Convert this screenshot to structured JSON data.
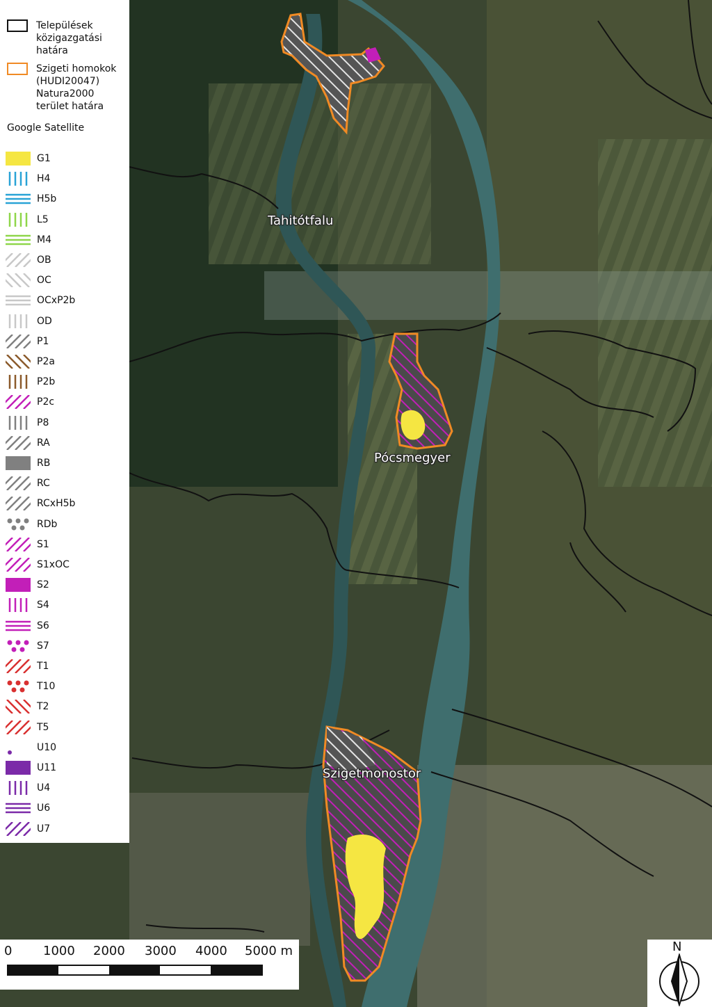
{
  "legend": {
    "boundary_label": "Települések közigazgatási határa",
    "natura_label": "Szigeti homokok (HUDI20047) Natura2000 terület határa",
    "basemap_label": "Google Satellite",
    "items": [
      {
        "code": "G1",
        "color": "#f5e642",
        "pattern": "solid"
      },
      {
        "code": "H4",
        "color": "#29a3d6",
        "pattern": "vert"
      },
      {
        "code": "H5b",
        "color": "#29a3d6",
        "pattern": "horiz"
      },
      {
        "code": "L5",
        "color": "#8fd64a",
        "pattern": "vert"
      },
      {
        "code": "M4",
        "color": "#8fd64a",
        "pattern": "horiz"
      },
      {
        "code": "OB",
        "color": "#c8c8c8",
        "pattern": "diag"
      },
      {
        "code": "OC",
        "color": "#c8c8c8",
        "pattern": "back"
      },
      {
        "code": "OCxP2b",
        "color": "#c8c8c8",
        "pattern": "horiz"
      },
      {
        "code": "OD",
        "color": "#c8c8c8",
        "pattern": "vert"
      },
      {
        "code": "P1",
        "color": "#808080",
        "pattern": "diag"
      },
      {
        "code": "P2a",
        "color": "#8b5a2b",
        "pattern": "back"
      },
      {
        "code": "P2b",
        "color": "#8b5a2b",
        "pattern": "vert"
      },
      {
        "code": "P2c",
        "color": "#c21fb8",
        "pattern": "diag"
      },
      {
        "code": "P8",
        "color": "#808080",
        "pattern": "vert"
      },
      {
        "code": "RA",
        "color": "#808080",
        "pattern": "diag"
      },
      {
        "code": "RB",
        "color": "#808080",
        "pattern": "solid"
      },
      {
        "code": "RC",
        "color": "#808080",
        "pattern": "diag"
      },
      {
        "code": "RCxH5b",
        "color": "#808080",
        "pattern": "diag"
      },
      {
        "code": "RDb",
        "color": "#808080",
        "pattern": "dots"
      },
      {
        "code": "S1",
        "color": "#c21fb8",
        "pattern": "diag"
      },
      {
        "code": "S1xOC",
        "color": "#c21fb8",
        "pattern": "diag"
      },
      {
        "code": "S2",
        "color": "#c21fb8",
        "pattern": "solid"
      },
      {
        "code": "S4",
        "color": "#c21fb8",
        "pattern": "vert"
      },
      {
        "code": "S6",
        "color": "#c21fb8",
        "pattern": "horiz"
      },
      {
        "code": "S7",
        "color": "#c21fb8",
        "pattern": "dots"
      },
      {
        "code": "T1",
        "color": "#d93030",
        "pattern": "diag"
      },
      {
        "code": "T10",
        "color": "#d93030",
        "pattern": "dots"
      },
      {
        "code": "T2",
        "color": "#d93030",
        "pattern": "back"
      },
      {
        "code": "T5",
        "color": "#d93030",
        "pattern": "diag"
      },
      {
        "code": "U10",
        "color": "#7b2aa8",
        "pattern": "dot"
      },
      {
        "code": "U11",
        "color": "#7b2aa8",
        "pattern": "solid"
      },
      {
        "code": "U4",
        "color": "#7b2aa8",
        "pattern": "vert"
      },
      {
        "code": "U6",
        "color": "#7b2aa8",
        "pattern": "horiz"
      },
      {
        "code": "U7",
        "color": "#7b2aa8",
        "pattern": "diag"
      }
    ]
  },
  "places": {
    "tahitotfalu": "Tahitótfalu",
    "pocsmegyer": "Pócsmegyer",
    "szigetmonostor": "Szigetmonostor"
  },
  "scale": {
    "labels": [
      "0",
      "1000",
      "2000",
      "3000",
      "4000",
      "5000 m"
    ]
  },
  "north_label": "N",
  "colors": {
    "natura_boundary": "#f08a24",
    "admin_boundary": "#111111",
    "river": "#3f6e6e"
  }
}
